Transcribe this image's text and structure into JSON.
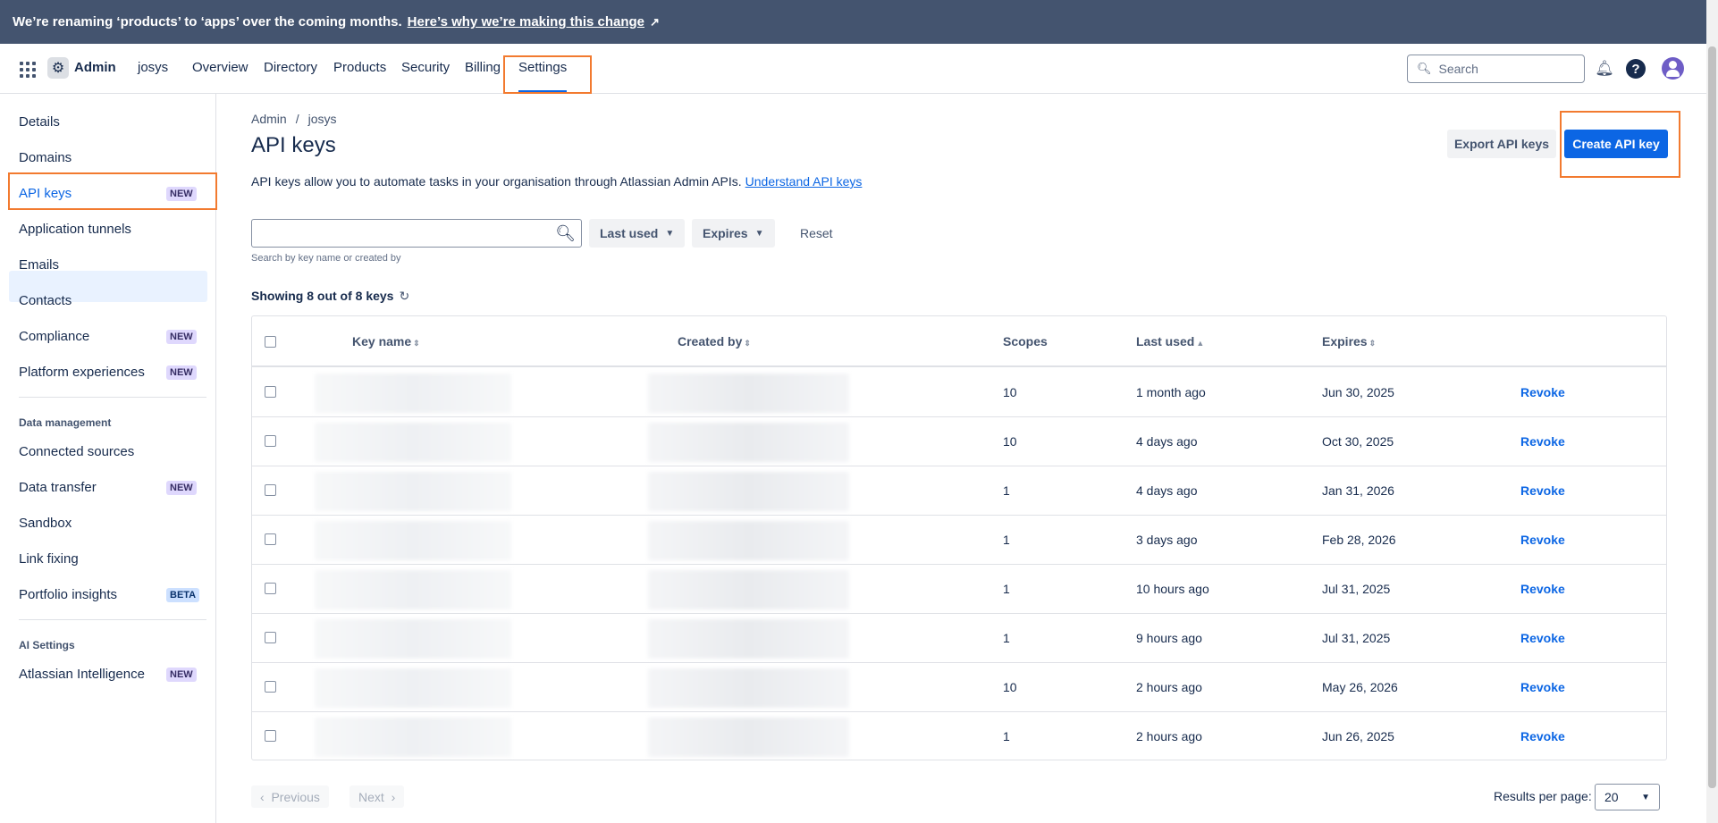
{
  "banner": {
    "text": "We’re renaming ‘products’ to ‘apps’ over the coming months.",
    "link": "Here’s why we’re making this change"
  },
  "topnav": {
    "admin_label": "Admin",
    "org": "josys",
    "items": [
      "Overview",
      "Directory",
      "Products",
      "Security",
      "Billing",
      "Settings"
    ],
    "active": "Settings",
    "search_placeholder": "Search"
  },
  "sidebar": {
    "items": [
      {
        "label": "Details"
      },
      {
        "label": "Domains"
      },
      {
        "label": "API keys",
        "badge": "NEW",
        "active": true
      },
      {
        "label": "Application tunnels"
      },
      {
        "label": "Emails"
      },
      {
        "label": "Contacts"
      },
      {
        "label": "Compliance",
        "badge": "NEW"
      },
      {
        "label": "Platform experiences",
        "badge": "NEW"
      }
    ],
    "data_management_heading": "Data management",
    "data_items": [
      {
        "label": "Connected sources"
      },
      {
        "label": "Data transfer",
        "badge": "NEW"
      },
      {
        "label": "Sandbox"
      },
      {
        "label": "Link fixing"
      },
      {
        "label": "Portfolio insights",
        "badge": "BETA"
      }
    ],
    "ai_heading": "AI Settings",
    "ai_items": [
      {
        "label": "Atlassian Intelligence",
        "badge": "NEW"
      }
    ]
  },
  "main": {
    "breadcrumb": [
      "Admin",
      "josys"
    ],
    "title": "API keys",
    "export_label": "Export API keys",
    "create_label": "Create API key",
    "description": "API keys allow you to automate tasks in your organisation through Atlassian Admin APIs.",
    "description_link": "Understand API keys",
    "search_hint": "Search by key name or created by",
    "filter_last_used": "Last used",
    "filter_expires": "Expires",
    "reset_label": "Reset",
    "showing": "Showing 8 out of 8 keys"
  },
  "table": {
    "headers": [
      "Key name",
      "Created by",
      "Scopes",
      "Last used",
      "Expires"
    ],
    "rows": [
      {
        "scopes": "10",
        "last_used": "1 month ago",
        "expires": "Jun 30, 2025",
        "action": "Revoke"
      },
      {
        "scopes": "10",
        "last_used": "4 days ago",
        "expires": "Oct 30, 2025",
        "action": "Revoke"
      },
      {
        "scopes": "1",
        "last_used": "4 days ago",
        "expires": "Jan 31, 2026",
        "action": "Revoke"
      },
      {
        "scopes": "1",
        "last_used": "3 days ago",
        "expires": "Feb 28, 2026",
        "action": "Revoke"
      },
      {
        "scopes": "1",
        "last_used": "10 hours ago",
        "expires": "Jul 31, 2025",
        "action": "Revoke"
      },
      {
        "scopes": "1",
        "last_used": "9 hours ago",
        "expires": "Jul 31, 2025",
        "action": "Revoke"
      },
      {
        "scopes": "10",
        "last_used": "2 hours ago",
        "expires": "May 26, 2026",
        "action": "Revoke"
      },
      {
        "scopes": "1",
        "last_used": "2 hours ago",
        "expires": "Jun 26, 2025",
        "action": "Revoke"
      }
    ]
  },
  "pagination": {
    "previous": "Previous",
    "next": "Next",
    "results_label": "Results per page:",
    "results_value": "20"
  },
  "colors": {
    "accent": "#0c66e4",
    "highlight": "#f27a2f",
    "banner_bg": "#44546f"
  }
}
